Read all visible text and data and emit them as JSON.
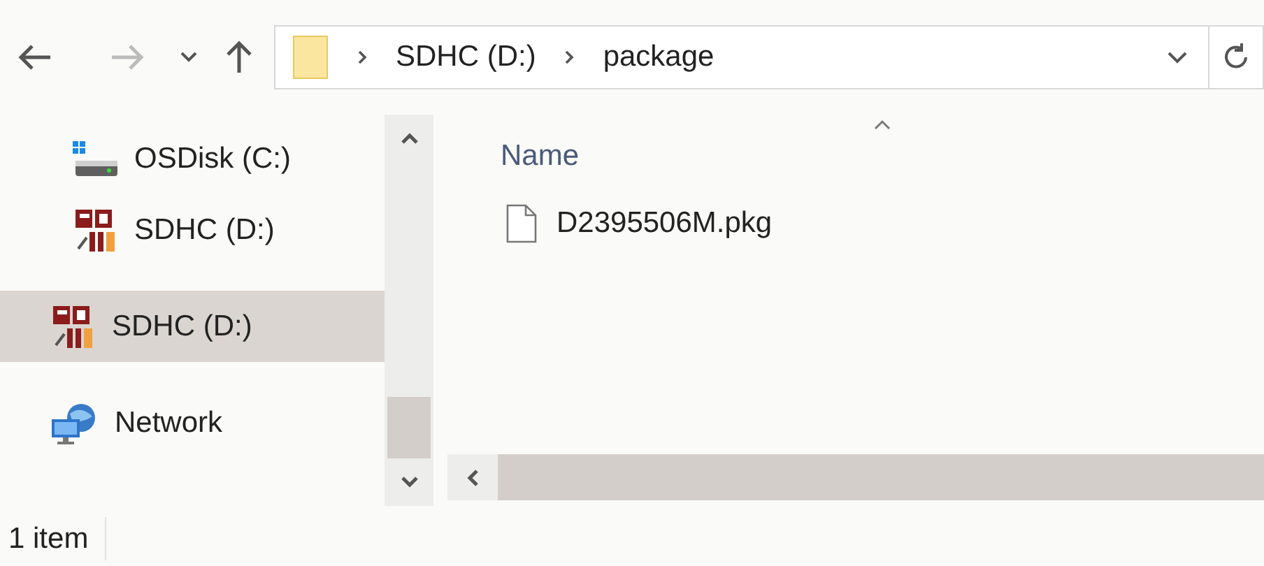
{
  "address_bar": {
    "crumbs": [
      "SDHC (D:)",
      "package"
    ]
  },
  "sidebar": {
    "items": [
      {
        "label": "OSDisk (C:)",
        "kind": "disk",
        "indent": true,
        "selected": false
      },
      {
        "label": "SDHC (D:)",
        "kind": "sd",
        "indent": true,
        "selected": false
      },
      {
        "label": "SDHC (D:)",
        "kind": "sd",
        "indent": false,
        "selected": true
      },
      {
        "label": "Network",
        "kind": "network",
        "indent": false,
        "selected": false
      }
    ]
  },
  "file_list": {
    "columns": [
      "Name"
    ],
    "files": [
      {
        "name": "D2395506M.pkg"
      }
    ]
  },
  "status_bar": {
    "count": "1 item"
  }
}
